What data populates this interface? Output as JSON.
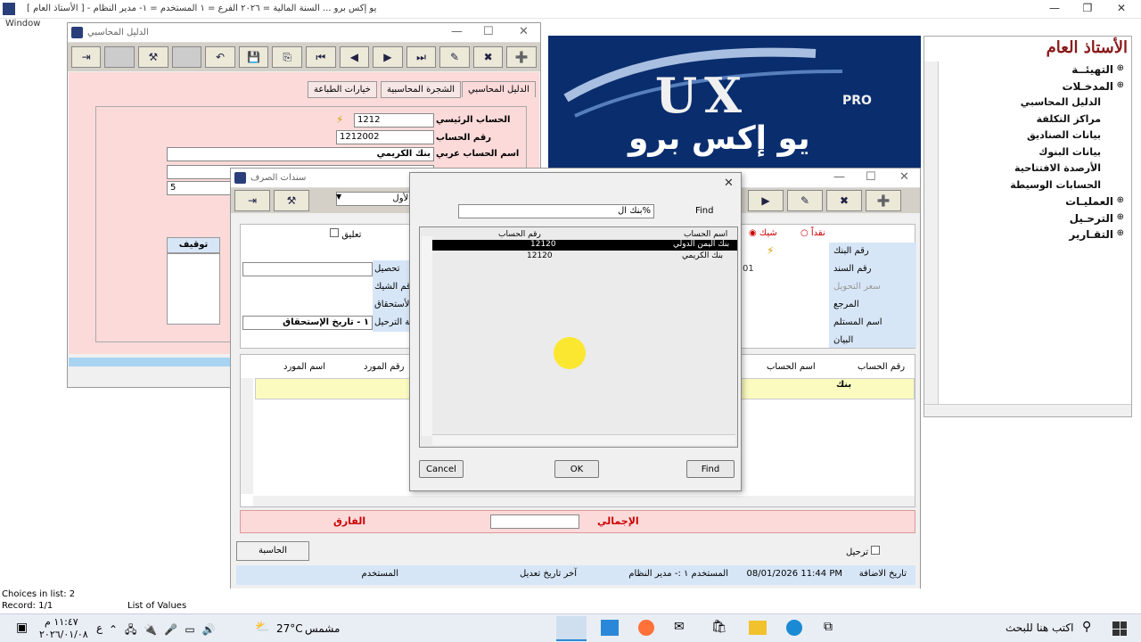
{
  "app": {
    "title": "يو إكس برو ...     السنة المالية = ٢٠٢٦     الفرع = ١     المستخدم = ١- مدير النظام - [ الأستاذ العام ]",
    "menu": "Window"
  },
  "win1": {
    "title": "الدليل المحاسبي",
    "tabs": [
      "الدليل المحاسبي",
      "الشجرة المحاسبية",
      "خيارات الطباعة"
    ],
    "labels": {
      "main": "الحساب الرئيسي",
      "num": "رقم الحساب",
      "name": "اسم الحساب عربي"
    },
    "values": {
      "main": "1212",
      "num": "1212002",
      "name": "بنك الكريمي",
      "extra": "5"
    },
    "stop": "توقيف"
  },
  "logo": {
    "en": "UX",
    "pro": "PRO",
    "ar": "يو إكس برو"
  },
  "tree": {
    "title": "الأستاذ العام",
    "items": [
      "التهيئــة",
      "المدخـلات",
      "الدليل المحاسبي",
      "مراكز التكلفة",
      "بيانات الصناديق",
      "بيانات البنوك",
      "الأرصدة الافتتاحية",
      "الحسابات الوسيطة",
      "العمليـات",
      "الترحـيل",
      "التقـارير"
    ]
  },
  "win2": {
    "title": "سندات الصرف",
    "cash": "نقداً",
    "check": "شيك",
    "hang": "تعليق",
    "first": "الأول",
    "labels": {
      "bank": "رقم البنك",
      "doc": "رقم السند",
      "rate": "سعر التحويل",
      "ref": "المرجع",
      "recv": "اسم المستلم",
      "stmt": "البيان",
      "coll": "تحصيل",
      "cheque": "رقم الشيك",
      "due": "الأستحقاق",
      "post": "طريقة الترحيل"
    },
    "postval": "١ - تاريخ الإستحقاق",
    "docval": "01",
    "grid": {
      "acct_no": "رقم الحساب",
      "acct_name": "اسم الحساب",
      "vend_no": "رقم المورد",
      "vend_name": "اسم المورد",
      "cell": "بنك"
    },
    "diff": "الفارق",
    "total": "الإجمالي",
    "calc": "الحاسبة",
    "posting": "ترحيل",
    "added": "تاريخ الاضافة",
    "added_val": "08/01/2026 11:44 PM",
    "user": "المستخدم",
    "user_val": "المستخدم ١ :- مدير النظام",
    "modified": "آخر تاريخ تعديل",
    "user2": "المستخدم"
  },
  "dialog": {
    "find_label": "Find",
    "search": "بنك ال%",
    "col_name": "اسم الحساب",
    "col_num": "رقم الحساب",
    "rows": [
      {
        "name": "بنك اليمن الدولي",
        "num": "12120"
      },
      {
        "name": "بنك الكريمي",
        "num": "12120"
      }
    ],
    "find": "Find",
    "ok": "OK",
    "cancel": "Cancel"
  },
  "status": {
    "choices": "Choices in list: 2",
    "record": "Record: 1/1",
    "lov": "List of Values"
  },
  "taskbar": {
    "search": "اكتب هنا للبحث",
    "weather": "مشمس",
    "temp": "27°C",
    "time": "١١:٤٧ م",
    "date": "٢٠٢٦/٠١/٠٨",
    "lang": "ع"
  }
}
